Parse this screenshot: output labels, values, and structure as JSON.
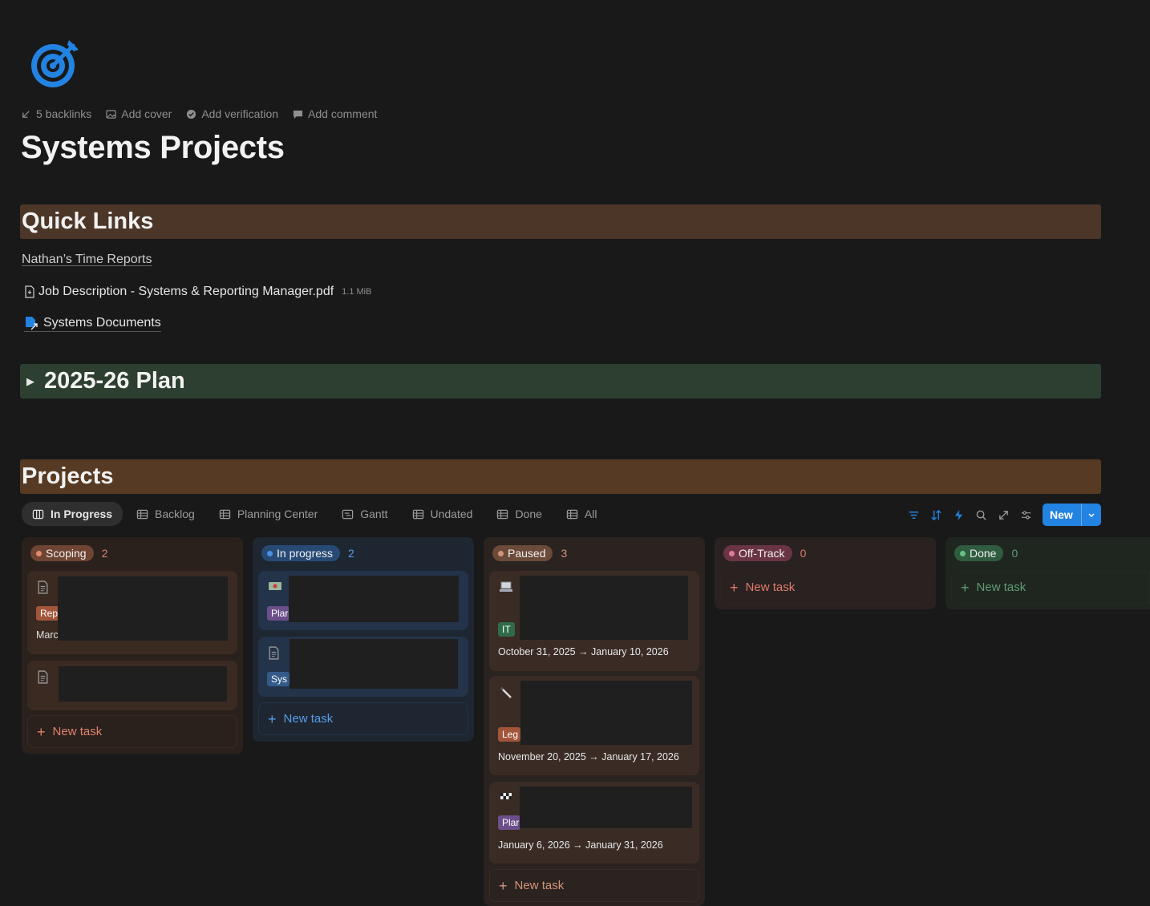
{
  "page": {
    "title": "Systems Projects",
    "meta": {
      "backlinks": "5 backlinks",
      "add_cover": "Add cover",
      "add_verification": "Add verification",
      "add_comment": "Add comment"
    }
  },
  "quick_links": {
    "heading": "Quick Links",
    "time_reports": "Nathan’s Time Reports",
    "file_name": "Job Description - Systems & Reporting Manager.pdf",
    "file_size": "1.1 MiB",
    "systems_documents": "Systems Documents"
  },
  "plan": {
    "heading": "2025-26 Plan"
  },
  "projects": {
    "heading": "Projects",
    "views": [
      {
        "label": "In Progress",
        "icon": "board-icon",
        "active": true
      },
      {
        "label": "Backlog",
        "icon": "table-icon"
      },
      {
        "label": "Planning Center",
        "icon": "table-icon"
      },
      {
        "label": "Gantt",
        "icon": "timeline-icon"
      },
      {
        "label": "Undated",
        "icon": "table-icon"
      },
      {
        "label": "Done",
        "icon": "table-icon"
      },
      {
        "label": "All",
        "icon": "table-icon"
      }
    ],
    "toolbar": {
      "icons": [
        "filter-icon",
        "sort-icon",
        "automation-icon",
        "search-icon",
        "expand-icon",
        "settings-icon"
      ],
      "new_label": "New",
      "accent": "#2383e2"
    },
    "columns": [
      {
        "status": "Scoping",
        "count": "2",
        "new_task": "New task",
        "colors": {
          "pill": "#6e4432",
          "dot": "#e3896b",
          "count": "#e0826a",
          "bg": "#2a211d",
          "card": "#3a2a22"
        },
        "cards": [
          {
            "icon": "document-icon",
            "tag": "Rep",
            "tag_color": "#a2553a",
            "line": "Marc"
          },
          {
            "icon": "document-icon"
          }
        ]
      },
      {
        "status": "In progress",
        "count": "2",
        "new_task": "New task",
        "colors": {
          "pill": "#274a75",
          "dot": "#4a90e2",
          "count": "#5a9ce8",
          "bg": "#1d2631",
          "card": "#23334a"
        },
        "cards": [
          {
            "icon": "money-icon",
            "tag": "Plar",
            "tag_color": "#6b4e8a"
          },
          {
            "icon": "document-icon",
            "tag": "Sys",
            "tag_color": "#345a8a"
          }
        ]
      },
      {
        "status": "Paused",
        "count": "3",
        "new_task": "New task",
        "colors": {
          "pill": "#6b4a39",
          "dot": "#d4937a",
          "count": "#d4937a",
          "bg": "#2a2320",
          "card": "#3a2c25"
        },
        "cards": [
          {
            "icon": "laptop-icon",
            "tag": "IT",
            "tag_color": "#2f6b4a",
            "date": "October 31, 2025 → January 10, 2026"
          },
          {
            "icon": "pen-icon",
            "tag": "Leg",
            "tag_color": "#a2553a",
            "date": "November 20, 2025 → January 17, 2026"
          },
          {
            "icon": "checkered-flag-icon",
            "tag": "Plar",
            "tag_color": "#6b4e8a",
            "date": "January 6, 2026 → January 31, 2026"
          }
        ]
      },
      {
        "status": "Off-Track",
        "count": "0",
        "new_task": "New task",
        "colors": {
          "pill": "#6a3445",
          "dot": "#e07a95",
          "count": "#e07a6a",
          "bg": "#2a2221",
          "card": "#2e2422"
        }
      },
      {
        "status": "Done",
        "count": "0",
        "new_task": "New task",
        "colors": {
          "pill": "#2f5c3f",
          "dot": "#6bbf85",
          "count": "#5f9c73",
          "bg": "#1f2620",
          "card": "#222b23"
        }
      }
    ]
  }
}
